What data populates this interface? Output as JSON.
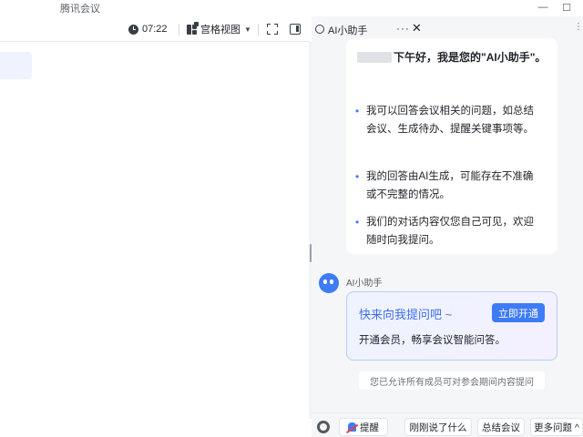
{
  "window": {
    "title": "腾讯会议",
    "minimize_glyph": "—",
    "maximize_glyph": "☐"
  },
  "toolbar": {
    "time": "07:22",
    "view_label": "宫格视图",
    "view_caret": "▼"
  },
  "ai_panel": {
    "tab_label": "AI小助手",
    "tab_more": "···",
    "tab_close": "✕",
    "right_more": "⋮",
    "greeting": "下午好，我是您的\"AI小助手\"。",
    "bullets": [
      "我可以回答会议相关的问题，如总结会议、生成待办、提醒关键事项等。",
      "我的回答由AI生成，可能存在不准确或不完整的情况。",
      "我们的对话内容仅您自己可见，欢迎随时向我提问。"
    ],
    "bot_name": "AI小助手",
    "promo_title": "快来向我提问吧 ~",
    "promo_button": "立即开通",
    "promo_desc": "开通会员，畅享会议智能问答。",
    "notice": "您已允许所有成员可对参会期间内容提问",
    "quick_actions": {
      "remind": "提醒",
      "just_said": "刚刚说了什么",
      "summarize": "总结会议",
      "more_questions": "更多问题 ^"
    }
  },
  "colors": {
    "accent": "#3d7bf7",
    "panel_bg": "#f5f6f8",
    "promo_border": "#b9cdf7"
  },
  "icons": [
    "clock-icon",
    "grid-view-icon",
    "fullscreen-icon",
    "side-panel-icon",
    "ai-assistant-icon",
    "bot-avatar-icon",
    "gear-icon",
    "remind-icon"
  ]
}
